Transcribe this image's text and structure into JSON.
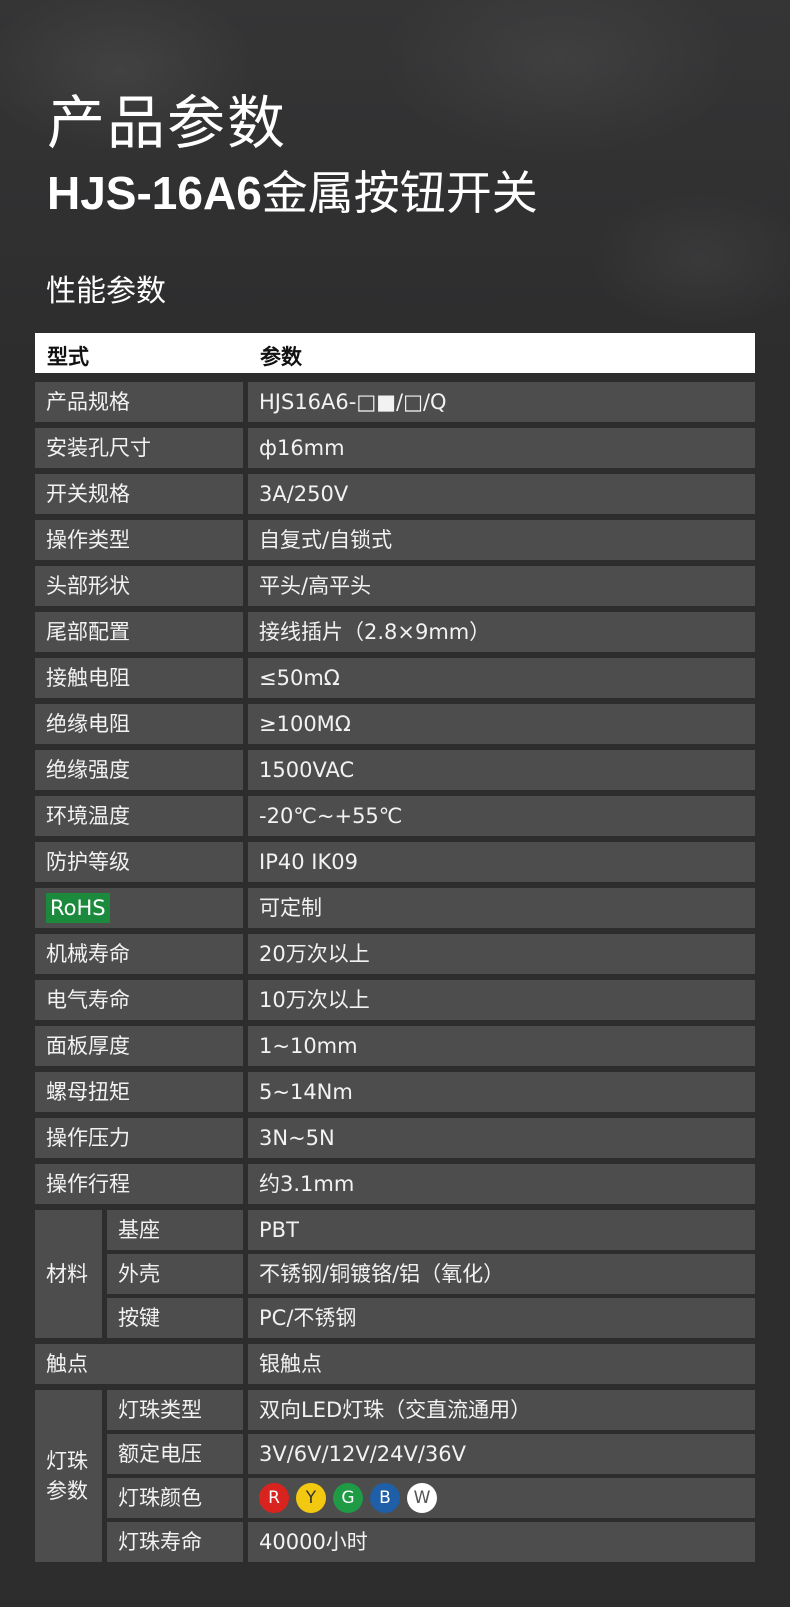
{
  "header": {
    "title": "产品参数",
    "subtitle_model": "HJS-16A6",
    "subtitle_text": "金属按钮开关"
  },
  "section_title": "性能参数",
  "table_head": {
    "col1": "型式",
    "col2": "参数"
  },
  "rows": [
    {
      "label": "产品规格",
      "value": "HJS16A6-□■/□/Q"
    },
    {
      "label": "安装孔尺寸",
      "value": "ф16mm"
    },
    {
      "label": "开关规格",
      "value": "3A/250V"
    },
    {
      "label": "操作类型",
      "value": "自复式/自锁式"
    },
    {
      "label": "头部形状",
      "value": "平头/高平头"
    },
    {
      "label": "尾部配置",
      "value": "接线插片（2.8×9mm）"
    },
    {
      "label": "接触电阻",
      "value": "≤50mΩ"
    },
    {
      "label": "绝缘电阻",
      "value": "≥100MΩ"
    },
    {
      "label": "绝缘强度",
      "value": "1500VAC"
    },
    {
      "label": "环境温度",
      "value": "-20℃~+55℃"
    },
    {
      "label": "防护等级",
      "value": "IP40   IK09"
    },
    {
      "label": "RoHS",
      "value": "可定制"
    },
    {
      "label": "机械寿命",
      "value": "20万次以上"
    },
    {
      "label": "电气寿命",
      "value": "10万次以上"
    },
    {
      "label": "面板厚度",
      "value": "1~10mm"
    },
    {
      "label": "螺母扭矩",
      "value": "5~14Nm"
    },
    {
      "label": "操作压力",
      "value": "3N~5N"
    },
    {
      "label": "操作行程",
      "value": "约3.1mm"
    }
  ],
  "material": {
    "label": "材料",
    "items": [
      {
        "label": "基座",
        "value": "PBT"
      },
      {
        "label": "外壳",
        "value": "不锈钢/铜镀铬/铝（氧化）"
      },
      {
        "label": "按键",
        "value": "PC/不锈钢"
      }
    ]
  },
  "contact": {
    "label": "触点",
    "value": "银触点"
  },
  "lamp": {
    "label_line1": "灯珠",
    "label_line2": "参数",
    "items": [
      {
        "label": "灯珠类型",
        "value": "双向LED灯珠（交直流通用）"
      },
      {
        "label": "额定电压",
        "value": "3V/6V/12V/24V/36V"
      },
      {
        "label": "灯珠颜色",
        "value": ""
      },
      {
        "label": "灯珠寿命",
        "value": "40000小时"
      }
    ],
    "colors": [
      {
        "letter": "R",
        "bg": "#d9231f",
        "fg": "#ffffff"
      },
      {
        "letter": "Y",
        "bg": "#f2c811",
        "fg": "#333333"
      },
      {
        "letter": "G",
        "bg": "#1f9a45",
        "fg": "#ffffff"
      },
      {
        "letter": "B",
        "bg": "#1f5fa8",
        "fg": "#ffffff"
      },
      {
        "letter": "W",
        "bg": "#ffffff",
        "fg": "#555555"
      }
    ]
  },
  "colors": {
    "page_bg": "#2d2d2e",
    "cell_bg": "#4d4d4e",
    "rohs_green": "#1b8a3c"
  }
}
